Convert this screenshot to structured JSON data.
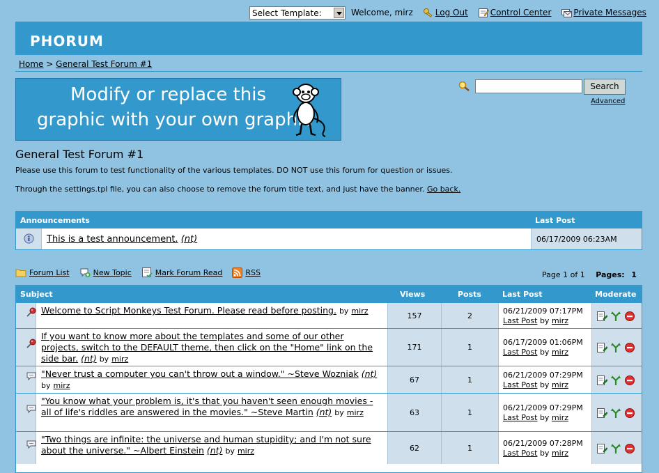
{
  "top": {
    "template_select": "Select Template:",
    "welcome": "Welcome, mirz",
    "logout": "Log Out",
    "control_center": "Control Center",
    "private_messages": "Private Messages"
  },
  "header": {
    "logo": "PHORUM"
  },
  "breadcrumb": {
    "home": "Home",
    "sep": ">",
    "forum": "General Test Forum #1"
  },
  "banner": {
    "line1": "Modify or replace this",
    "line2": "graphic with your own graphic"
  },
  "search": {
    "button": "Search",
    "advanced": "Advanced",
    "value": ""
  },
  "forum": {
    "title": "General Test Forum #1",
    "desc": "Please use this forum to test functionality of the various templates. DO NOT use this forum for question or issues.",
    "desc2": "Through the settings.tpl file, you can also choose to remove the forum title text, and just have the banner.",
    "go_back": "Go back."
  },
  "announcements": {
    "header": "Announcements",
    "last_post_header": "Last Post",
    "item": {
      "subject": "This is a test announcement.",
      "nt": "(nt)",
      "date": "06/17/2009 06:23AM"
    }
  },
  "nav": {
    "forum_list": "Forum List",
    "new_topic": "New Topic",
    "mark_read": "Mark Forum Read",
    "rss": "RSS",
    "page_of": "Page 1 of 1",
    "pages_label": "Pages:",
    "pages_value": "1"
  },
  "topics": {
    "headers": {
      "subject": "Subject",
      "views": "Views",
      "posts": "Posts",
      "last_post": "Last Post",
      "moderate": "Moderate"
    },
    "by": "by",
    "last_post_link": "Last Post",
    "rows": [
      {
        "icon": "sticky-pin-icon",
        "subject": "Welcome to Script Monkeys Test Forum. Please read before posting.",
        "nt": "",
        "author": "mirz",
        "views": "157",
        "posts": "2",
        "date": "06/21/2009 07:17PM",
        "last_author": "mirz"
      },
      {
        "icon": "sticky-pin-icon",
        "subject": "If you want to know more about the templates and some of our other projects, switch to the DEFAULT theme, then click on the \"Home\" link on the side bar.",
        "nt": "(nt)",
        "author": "mirz",
        "views": "171",
        "posts": "1",
        "date": "06/17/2009 01:06PM",
        "last_author": "mirz"
      },
      {
        "icon": "speech-bubble-icon",
        "subject": "\"Never trust a computer you can't throw out a window.\" ~Steve Wozniak",
        "nt": "(nt)",
        "author": "mirz",
        "views": "67",
        "posts": "1",
        "date": "06/21/2009 07:29PM",
        "last_author": "mirz"
      },
      {
        "icon": "speech-bubble-icon",
        "subject": "\"You know what your problem is, it's that you haven't seen enough movies - all of life's riddles are answered in the movies.\" ~Steve Martin",
        "nt": "(nt)",
        "author": "mirz",
        "views": "63",
        "posts": "1",
        "date": "06/21/2009 07:29PM",
        "last_author": "mirz"
      },
      {
        "icon": "speech-bubble-icon",
        "subject": "\"Two things are infinite: the universe and human stupidity; and I'm not sure about the universe.\" ~Albert Einstein",
        "nt": "(nt)",
        "author": "mirz",
        "views": "62",
        "posts": "1",
        "date": "06/21/2009 07:28PM",
        "last_author": "mirz"
      }
    ]
  }
}
